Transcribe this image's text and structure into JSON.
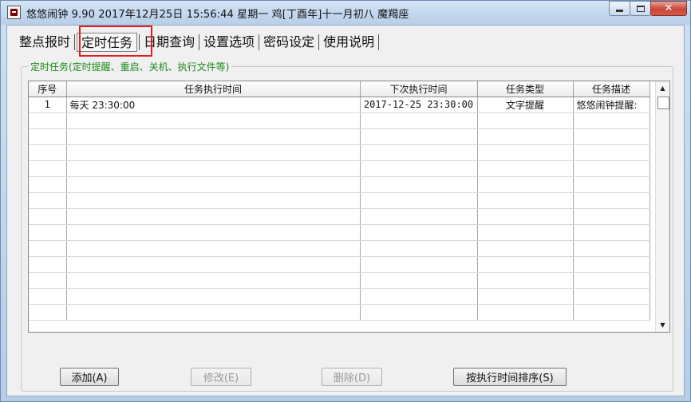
{
  "window": {
    "title": "悠悠闹钟 9.90 2017年12月25日 15:56:44 星期一 鸡[丁酉年]十一月初八 魔羯座"
  },
  "tabs": [
    {
      "label": "整点报时"
    },
    {
      "label": "定时任务",
      "active": true
    },
    {
      "label": "日期查询"
    },
    {
      "label": "设置选项"
    },
    {
      "label": "密码设定"
    },
    {
      "label": "使用说明"
    }
  ],
  "group": {
    "legend": "定时任务(定时提醒、重启、关机、执行文件等)"
  },
  "table": {
    "columns": [
      "序号",
      "任务执行时间",
      "下次执行时间",
      "任务类型",
      "任务描述"
    ],
    "rows": [
      [
        "1",
        "每天 23:30:00",
        "2017-12-25 23:30:00",
        "文字提醒",
        "悠悠闹钟提醒:"
      ]
    ],
    "empty_rows": 13
  },
  "buttons": {
    "add": "添加(A)",
    "edit": "修改(E)",
    "delete": "删除(D)",
    "sort": "按执行时间排序(S)"
  }
}
